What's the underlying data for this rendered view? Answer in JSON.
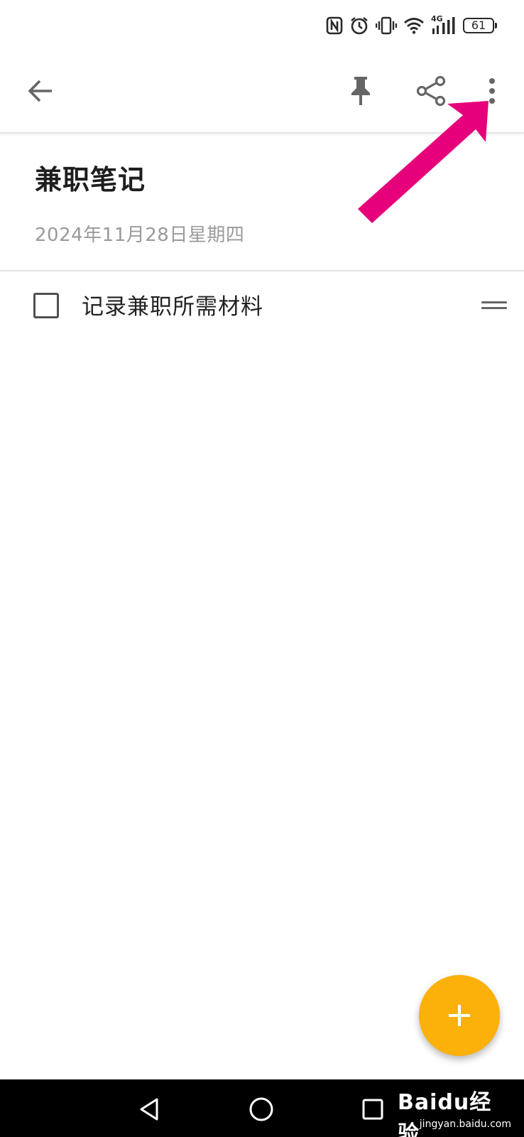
{
  "status_bar": {
    "battery_level": "61",
    "network_label": "4G",
    "icons": [
      "nfc-icon",
      "alarm-icon",
      "vibrate-icon",
      "wifi-icon",
      "signal-icon",
      "battery-icon"
    ]
  },
  "toolbar": {
    "icons": [
      "back-arrow-icon",
      "pin-icon",
      "share-icon",
      "more-vertical-icon"
    ]
  },
  "note": {
    "title": "兼职笔记",
    "date": "2024年11月28日星期四"
  },
  "checklist": {
    "items": [
      {
        "text": "记录兼职所需材料",
        "checked": false
      }
    ]
  },
  "fab": {
    "icon": "plus-icon",
    "color": "#fbb00a"
  },
  "annotation": {
    "color": "#e6007a",
    "icon": "arrow-annotation-icon"
  },
  "navigation_bar": {
    "icons": [
      "nav-back-icon",
      "nav-home-icon",
      "nav-recent-icon"
    ]
  },
  "watermark": {
    "brand": "Baidu经验",
    "url": "jingyan.baidu.com"
  }
}
